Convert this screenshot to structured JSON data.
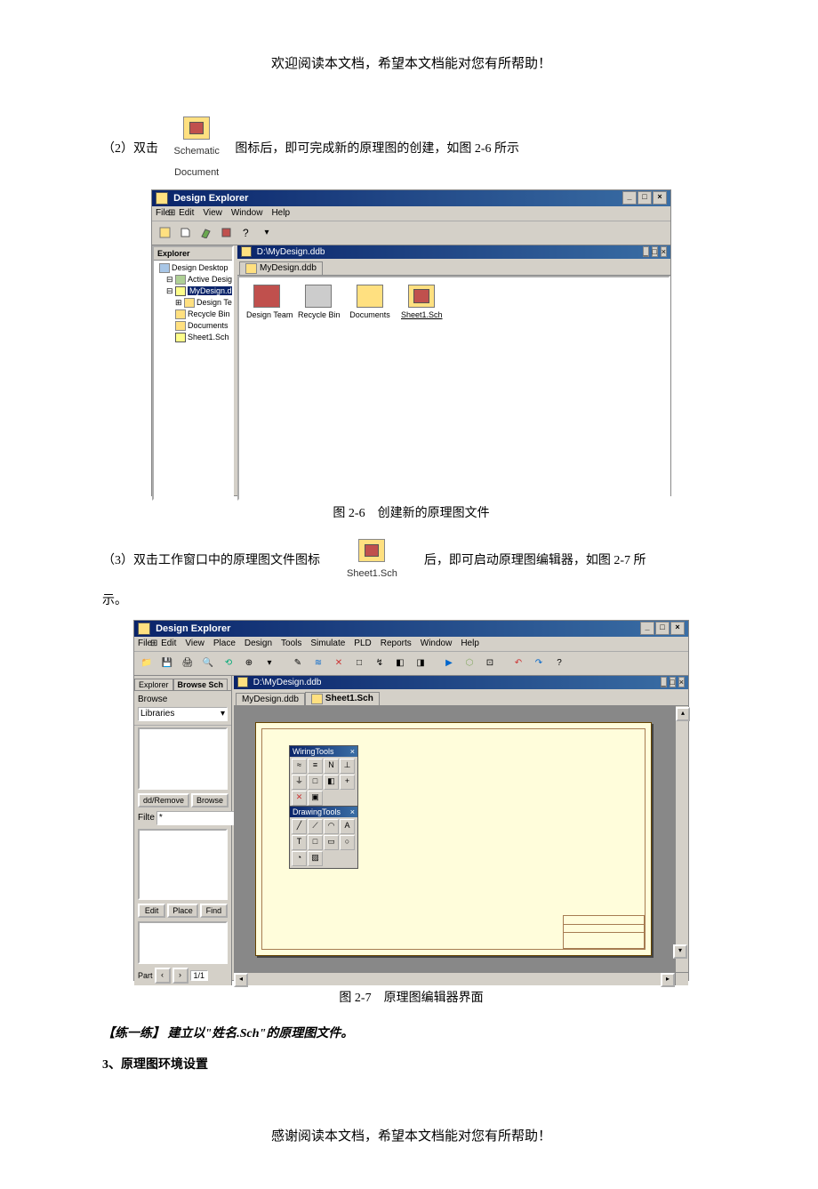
{
  "header": "欢迎阅读本文档，希望本文档能对您有所帮助！",
  "footer": "感谢阅读本文档，希望本文档能对您有所帮助！",
  "p2_prefix": "（2）双击",
  "p2_suffix": "图标后，即可完成新的原理图的创建，如图 2-6 所示",
  "icon_schematic_line1": "Schematic",
  "icon_schematic_line2": "Document",
  "fig26_caption": "图 2-6　创建新的原理图文件",
  "p3_prefix": "（3）双击工作窗口中的原理图文件图标",
  "p3_suffix": "后，即可启动原理图编辑器，如图 2-7 所",
  "p3_tail": "示。",
  "icon_sheet1": "Sheet1.Sch",
  "fig27_caption": "图 2-7　原理图编辑器界面",
  "practice": "【练一练】 建立以\"姓名.Sch\"的原理图文件。",
  "section3": "3、原理图环境设置",
  "windows": {
    "app_title": "Design Explorer",
    "menus1": [
      "File",
      "Edit",
      "View",
      "Window",
      "Help"
    ],
    "menus2": [
      "File",
      "Edit",
      "View",
      "Place",
      "Design",
      "Tools",
      "Simulate",
      "PLD",
      "Reports",
      "Window",
      "Help"
    ],
    "explorer_tab": "Explorer",
    "browse_sch_tab": "Browse Sch",
    "inner_title": "D:\\MyDesign.ddb",
    "tab_label": "MyDesign.ddb",
    "tab_label2": "Sheet1.Sch",
    "tree": {
      "root": "Design Desktop",
      "ads": "Active Design Stations",
      "proj": "MyDesign.ddb",
      "team": "Design Team",
      "recycle": "Recycle Bin",
      "docs": "Documents",
      "sheet": "Sheet1.Sch"
    },
    "icons": {
      "design_team": "Design Team",
      "recycle": "Recycle Bin",
      "documents": "Documents",
      "sheet1": "Sheet1.Sch"
    },
    "panel": {
      "browse": "Browse",
      "libraries": "Libraries",
      "add_remove": "dd/Remove",
      "browse_btn": "Browse",
      "filter": "Filte",
      "filter_val": "*",
      "edit": "Edit",
      "place": "Place",
      "find": "Find",
      "part": "Part",
      "page": "1/1"
    },
    "float": {
      "wiring": "WiringTools",
      "drawing": "DrawingTools"
    }
  }
}
